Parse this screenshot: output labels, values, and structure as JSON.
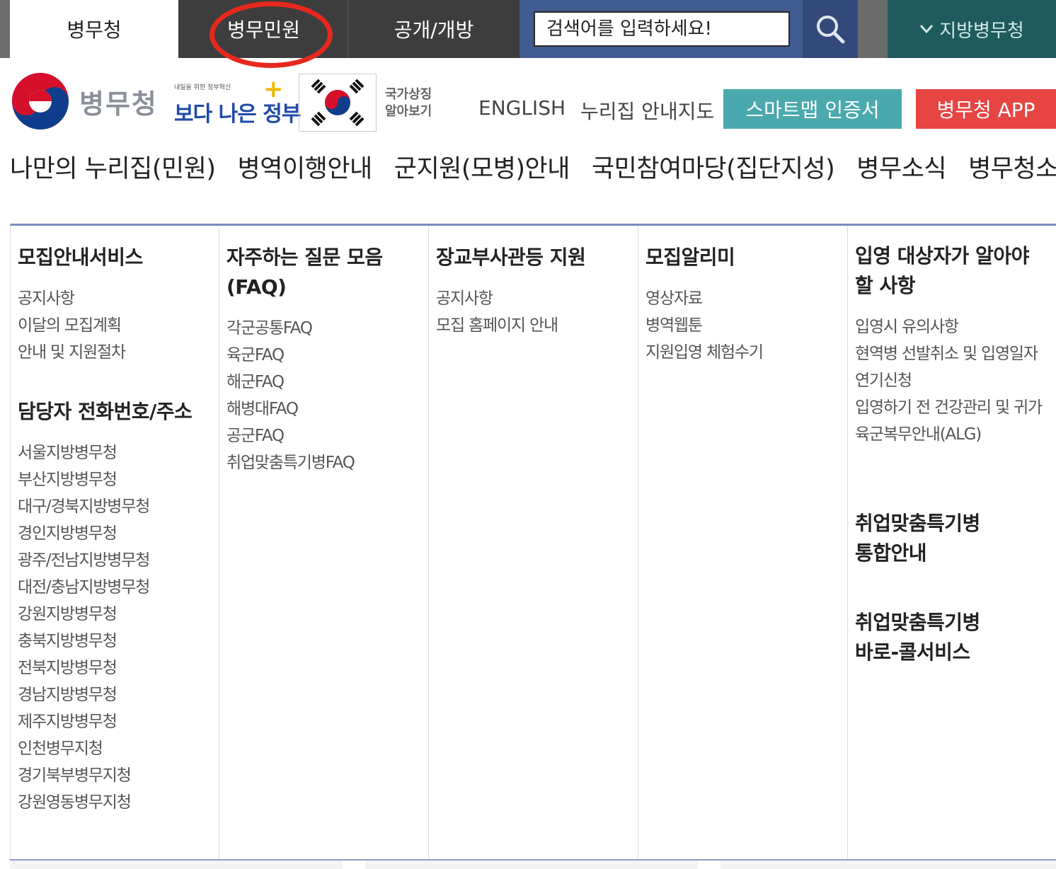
{
  "topbar": {
    "tabs": [
      "병무청",
      "병무민원",
      "공개/개방"
    ],
    "search_placeholder": "검색어를 입력하세요!",
    "region_label": "지방병무청",
    "region_chevron": "chevron-down-icon"
  },
  "header": {
    "logo_text": "병무청",
    "slogan_small": "내일을 위한 정부혁신",
    "slogan_big": "보다 나은 정부",
    "flag_label": "국가상징 알아보기",
    "english": "ENGLISH",
    "sitemap": "누리집 안내지도",
    "smart_cert": "스마트맵 인증서",
    "app": "병무청 APP",
    "colors": {
      "smart": "#4aa9ad",
      "app": "#e64544",
      "region": "#1f5a5e",
      "search": "#3f5b8f"
    }
  },
  "nav": [
    "나만의 누리집(민원)",
    "병역이행안내",
    "군지원(모병)안내",
    "국민참여마당(집단지성)",
    "병무소식",
    "병무청소개"
  ],
  "mega": {
    "col1": {
      "title1": "모집안내서비스",
      "links1": [
        "공지사항",
        "이달의 모집계획",
        "안내 및 지원절차"
      ],
      "title2": "담당자 전화번호/주소",
      "links2": [
        "서울지방병무청",
        "부산지방병무청",
        "대구/경북지방병무청",
        "경인지방병무청",
        "광주/전남지방병무청",
        "대전/충남지방병무청",
        "강원지방병무청",
        "충북지방병무청",
        "전북지방병무청",
        "경남지방병무청",
        "제주지방병무청",
        "인천병무지청",
        "경기북부병무지청",
        "강원영동병무지청"
      ]
    },
    "col2": {
      "title_line1": "자주하는 질문 모음",
      "title_line2": "(FAQ)",
      "links": [
        "각군공통FAQ",
        "육군FAQ",
        "해군FAQ",
        "해병대FAQ",
        "공군FAQ",
        "취업맞춤특기병FAQ"
      ]
    },
    "col3": {
      "title": "장교부사관등 지원",
      "links": [
        "공지사항",
        "모집 홈페이지 안내"
      ]
    },
    "col4": {
      "title": "모집알리미",
      "links": [
        "영상자료",
        "병역웹툰",
        "지원입영 체험수기"
      ]
    },
    "col5": {
      "title_line1": "입영 대상자가 알아야",
      "title_line2": "할 사항",
      "links": [
        "입영시 유의사항",
        "현역병 선발취소 및 입영일자",
        "연기신청",
        "입영하기 전 건강관리 및 귀가",
        "육군복무안내(ALG)"
      ],
      "title2_line1": "취업맞춤특기병",
      "title2_line2": "통합안내",
      "title3_line1": "취업맞춤특기병",
      "title3_line2": "바로-콜서비스"
    }
  }
}
